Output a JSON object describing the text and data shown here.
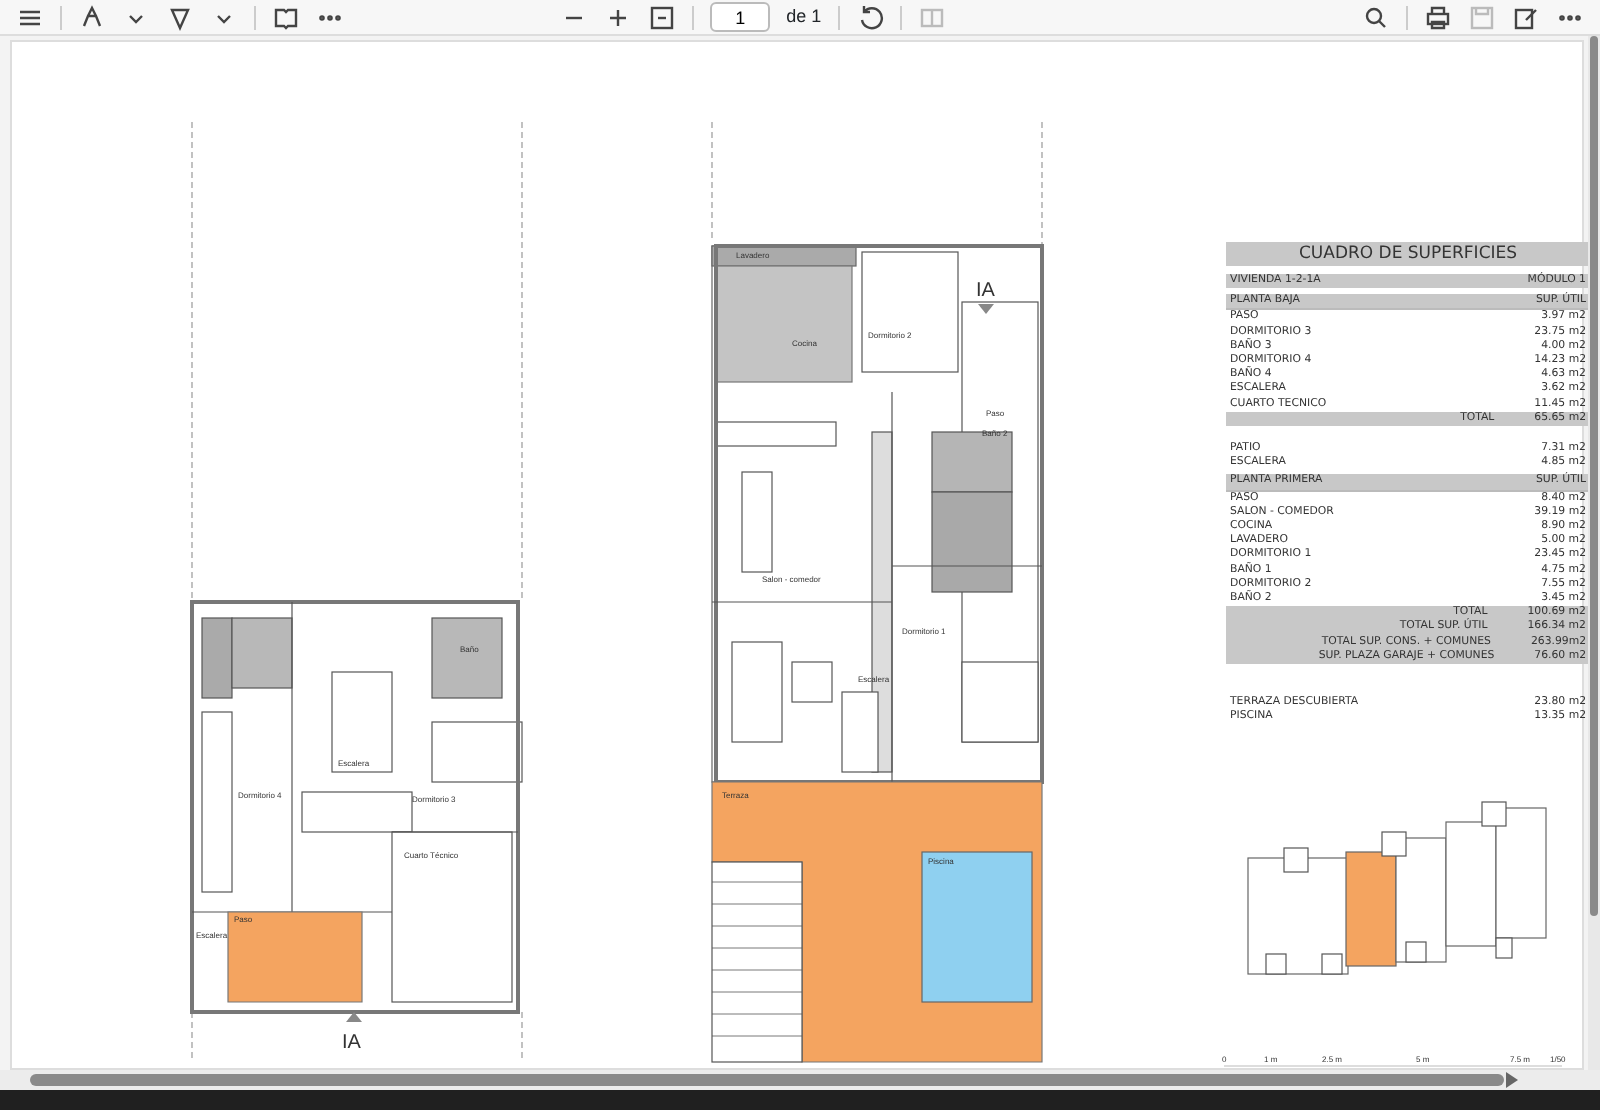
{
  "toolbar": {
    "page_number": "1",
    "page_count": "de 1"
  },
  "upper_plan": {
    "section_mark": "IA",
    "labels": [
      "Lavadero",
      "Dormitorio 2",
      "Cocina",
      "Paso",
      "Baño 2",
      "Salon - comedor",
      "Dormitorio 1",
      "Escalera",
      "Terraza",
      "Piscina"
    ]
  },
  "lower_plan": {
    "section_mark": "IA",
    "labels": [
      "Baño",
      "Dormitorio 4",
      "Escalera",
      "Dormitorio 3",
      "Cuarto Técnico",
      "Paso",
      "Escalera"
    ]
  },
  "surface_table": {
    "title": "CUADRO DE SUPERFICIES",
    "unit": "VIVIENDA 1-2-1A",
    "module": "MÓDULO 1",
    "rows": [
      {
        "kind": "header",
        "label": "PLANTA BAJA",
        "value": "SUP. ÚTIL"
      },
      {
        "kind": "row",
        "label": "PASO",
        "value": "3.97 m2"
      },
      {
        "kind": "row",
        "label": "DORMITORIO 3",
        "value": "23.75 m2"
      },
      {
        "kind": "row",
        "label": "BAÑO 3",
        "value": "4.00 m2"
      },
      {
        "kind": "row",
        "label": "DORMITORIO 4",
        "value": "14.23 m2"
      },
      {
        "kind": "row",
        "label": "BAÑO 4",
        "value": "4.63 m2"
      },
      {
        "kind": "row",
        "label": "ESCALERA",
        "value": "3.62 m2"
      },
      {
        "kind": "row",
        "label": "CUARTO TECNICO",
        "value": "11.45 m2"
      },
      {
        "kind": "total",
        "label": "TOTAL",
        "value": "65.65 m2"
      },
      {
        "kind": "gap"
      },
      {
        "kind": "row",
        "label": "PATIO",
        "value": "7.31 m2"
      },
      {
        "kind": "row",
        "label": "ESCALERA",
        "value": "4.85 m2"
      },
      {
        "kind": "header",
        "label": "PLANTA PRIMERA",
        "value": "SUP. ÚTIL"
      },
      {
        "kind": "row",
        "label": "PASO",
        "value": "8.40 m2"
      },
      {
        "kind": "row",
        "label": "SALON - COMEDOR",
        "value": "39.19 m2"
      },
      {
        "kind": "row",
        "label": "COCINA",
        "value": "8.90 m2"
      },
      {
        "kind": "row",
        "label": "LAVADERO",
        "value": "5.00 m2"
      },
      {
        "kind": "row",
        "label": "DORMITORIO 1",
        "value": "23.45 m2"
      },
      {
        "kind": "row",
        "label": "BAÑO 1",
        "value": "4.75 m2"
      },
      {
        "kind": "row",
        "label": "DORMITORIO 2",
        "value": "7.55 m2"
      },
      {
        "kind": "row",
        "label": "BAÑO 2",
        "value": "3.45 m2"
      },
      {
        "kind": "total",
        "label": "TOTAL",
        "value": "100.69 m2"
      },
      {
        "kind": "total",
        "label": "TOTAL SUP. ÚTIL",
        "value": "166.34 m2"
      },
      {
        "kind": "total",
        "label": "TOTAL SUP. CONS. + COMUNES",
        "value": "263.99m2"
      },
      {
        "kind": "total",
        "label": "SUP. PLAZA GARAJE + COMUNES",
        "value": "76.60 m2"
      },
      {
        "kind": "gap"
      },
      {
        "kind": "gap"
      },
      {
        "kind": "row",
        "label": "TERRAZA DESCUBIERTA",
        "value": "23.80 m2"
      },
      {
        "kind": "row",
        "label": "PISCINA",
        "value": "13.35 m2"
      }
    ]
  },
  "scale_bar": [
    "0",
    "1 m",
    "2.5 m",
    "5 m",
    "7.5 m",
    "1/50"
  ]
}
